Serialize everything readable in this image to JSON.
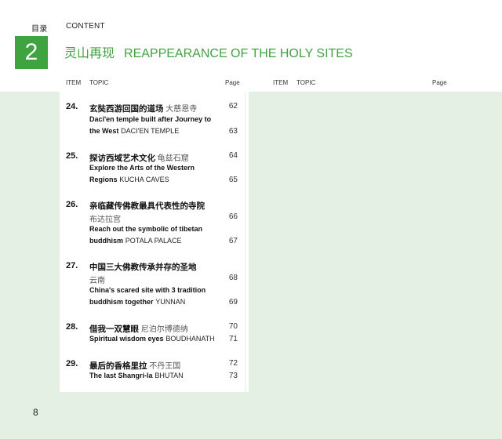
{
  "header": {
    "cn_label": "目录",
    "en_label": "CONTENT",
    "chapter_number": "2",
    "chapter_cn": "灵山再现",
    "chapter_en": "REAPPEARANCE OF THE HOLY SITES"
  },
  "columns": {
    "left": {
      "item": "ITEM",
      "topic": "TOPIC",
      "page": "Page"
    },
    "right": {
      "item": "ITEM",
      "topic": "TOPIC",
      "page": "Page"
    }
  },
  "entries": [
    {
      "num": "24.",
      "cn_title": "玄奘西游回国的道场",
      "cn_sub": "大慈恩寺",
      "cn_page": "62",
      "en_line1": "Daci'en temple built after Journey to",
      "en_line2_bold": "the West",
      "en_line2_reg": "DACI'EN TEMPLE",
      "en_page": "63"
    },
    {
      "num": "25.",
      "cn_title": "探访西域艺术文化",
      "cn_sub": "龟兹石窟",
      "cn_page": "64",
      "en_line1": "Explore the Arts of the Western",
      "en_line2_bold": "Regions",
      "en_line2_reg": "KUCHA CAVES",
      "en_page": "65"
    },
    {
      "num": "26.",
      "cn_title": "亲临藏传佛教最具代表性的寺院",
      "cn_sub": "布达拉宫",
      "cn_page": "66",
      "en_line1": "Reach out the symbolic of tibetan",
      "en_line2_bold": "buddhism",
      "en_line2_reg": "POTALA PALACE",
      "en_page": "67"
    },
    {
      "num": "27.",
      "cn_title": "中国三大佛教传承并存的圣地",
      "cn_sub": "云南",
      "cn_page": "68",
      "en_line1": "China's scared site with 3 tradition",
      "en_line2_bold": "buddhism together",
      "en_line2_reg": "YUNNAN",
      "en_page": "69"
    },
    {
      "num": "28.",
      "cn_title": "借我一双慧眼",
      "cn_sub": "尼泊尔博德纳",
      "cn_page": "70",
      "en_line1_bold": "Spiritual wisdom eyes",
      "en_line1_reg": "BOUDHANATH",
      "en_page": "71"
    },
    {
      "num": "29.",
      "cn_title": "最后的香格里拉",
      "cn_sub": "不丹王国",
      "cn_page": "72",
      "en_line1_bold": "The last Shangri-la",
      "en_line1_reg": "BHUTAN",
      "en_page": "73"
    }
  ],
  "folio": "8",
  "colors": {
    "accent_green": "#3fa33f",
    "background_green": "#e3f0e3"
  }
}
